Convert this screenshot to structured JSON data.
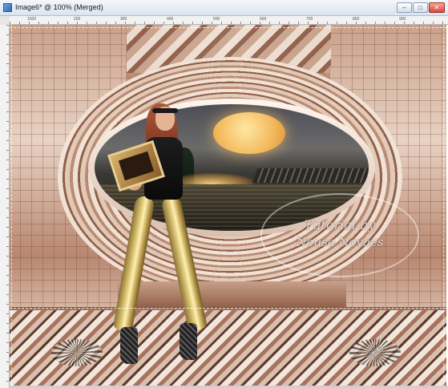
{
  "window": {
    "title": "Image6* @ 100% (Merged)",
    "controls": {
      "minimize": "–",
      "maximize": "□",
      "close": "✕"
    }
  },
  "ruler": {
    "top_ticks": [
      "1500",
      "200",
      "300",
      "400",
      "500",
      "600",
      "700",
      "800",
      "900"
    ]
  },
  "canvas": {
    "watermark": {
      "line1": "Tutorial by",
      "line2": "Neusa Novaes"
    }
  },
  "colors": {
    "titlebar": "#dbe4ef",
    "canvas_base": "#8a5a44",
    "moon": "#f3b95b",
    "leggings": "#e3cd7d"
  }
}
